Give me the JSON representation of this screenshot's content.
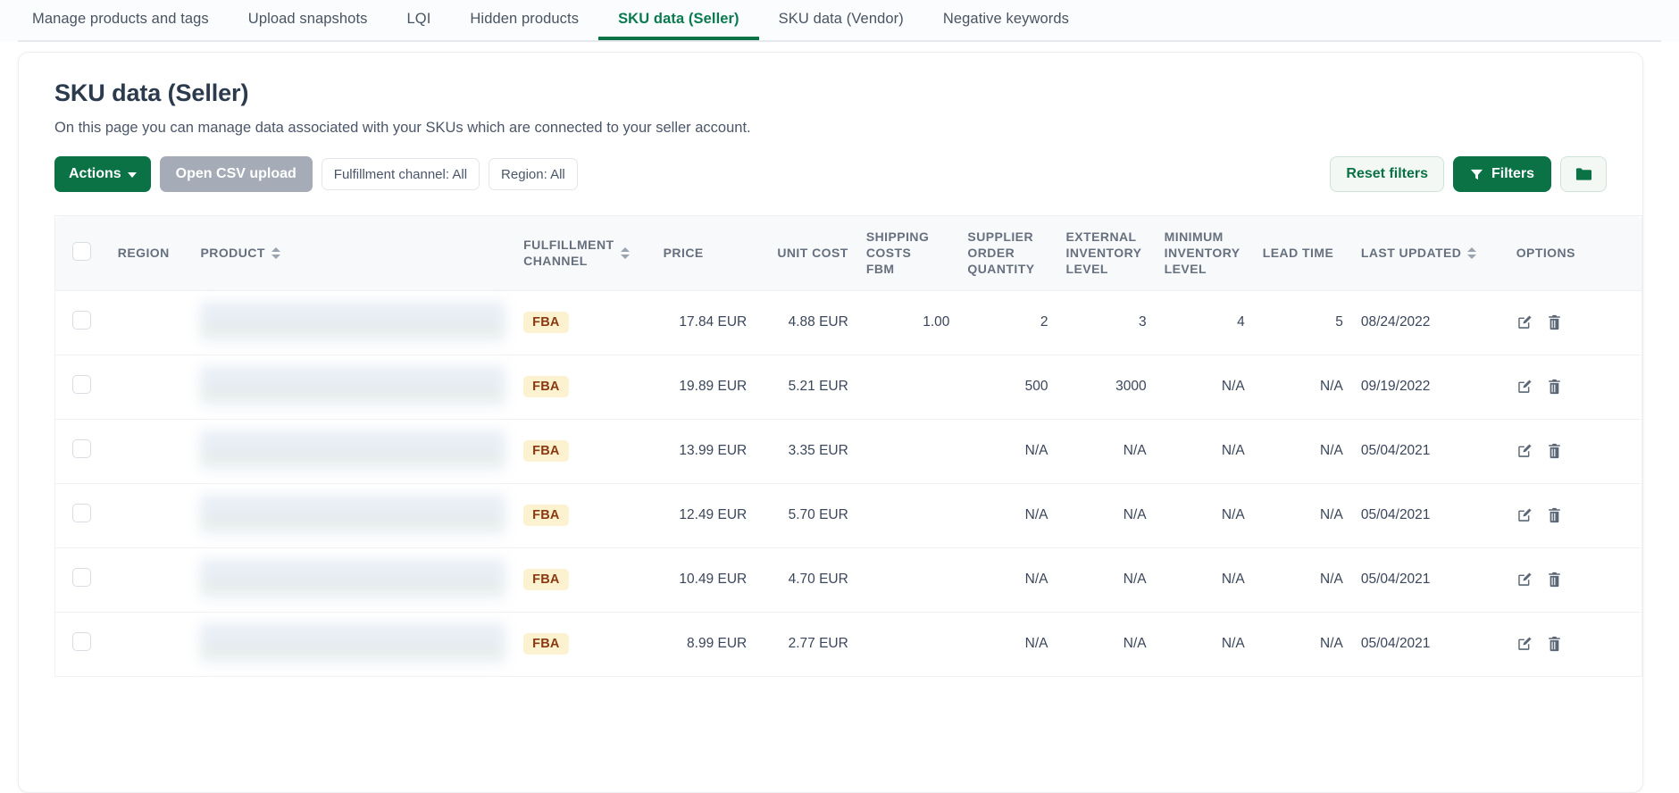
{
  "tabs": [
    {
      "label": "Manage products and tags",
      "active": false
    },
    {
      "label": "Upload snapshots",
      "active": false
    },
    {
      "label": "LQI",
      "active": false
    },
    {
      "label": "Hidden products",
      "active": false
    },
    {
      "label": "SKU data (Seller)",
      "active": true
    },
    {
      "label": "SKU data (Vendor)",
      "active": false
    },
    {
      "label": "Negative keywords",
      "active": false
    }
  ],
  "page": {
    "title": "SKU data (Seller)",
    "description": "On this page you can manage data associated with your SKUs which are connected to your seller account."
  },
  "toolbar": {
    "actions_label": "Actions",
    "csv_label": "Open CSV upload",
    "chip_fulfillment": "Fulfillment channel: All",
    "chip_region": "Region: All",
    "reset_label": "Reset filters",
    "filters_label": "Filters",
    "folder_icon": "folder-icon",
    "filter_icon": "funnel-icon"
  },
  "colors": {
    "brand_green": "#0a7245",
    "tab_active": "#0a7a4f",
    "na_red": "#f5333f",
    "badge_bg": "#fdf2cf",
    "badge_fg": "#8a3a12",
    "csv_gray": "#a5acb7"
  },
  "table": {
    "columns": [
      {
        "key": "select",
        "label": "",
        "sortable": false,
        "align": "center"
      },
      {
        "key": "region",
        "label": "REGION",
        "sortable": false,
        "align": "left"
      },
      {
        "key": "product",
        "label": "PRODUCT",
        "sortable": true,
        "align": "left"
      },
      {
        "key": "channel",
        "label": "FULFILLMENT CHANNEL",
        "sortable": true,
        "align": "left"
      },
      {
        "key": "price",
        "label": "PRICE",
        "sortable": false,
        "align": "right"
      },
      {
        "key": "unitcost",
        "label": "UNIT COST",
        "sortable": false,
        "align": "right"
      },
      {
        "key": "shipfbm",
        "label": "SHIPPING COSTS FBM",
        "sortable": false,
        "align": "right"
      },
      {
        "key": "supplier",
        "label": "SUPPLIER ORDER QUANTITY",
        "sortable": false,
        "align": "right"
      },
      {
        "key": "external",
        "label": "EXTERNAL INVENTORY LEVEL",
        "sortable": false,
        "align": "right"
      },
      {
        "key": "minimum",
        "label": "MINIMUM INVENTORY LEVEL",
        "sortable": false,
        "align": "right"
      },
      {
        "key": "leadtime",
        "label": "LEAD TIME",
        "sortable": false,
        "align": "right"
      },
      {
        "key": "updated",
        "label": "LAST UPDATED",
        "sortable": true,
        "align": "left"
      },
      {
        "key": "options",
        "label": "OPTIONS",
        "sortable": false,
        "align": "left"
      }
    ],
    "header_labels": {
      "region": "REGION",
      "product": "PRODUCT",
      "channel_line1": "FULFILLMENT",
      "channel_line2": "CHANNEL",
      "price": "PRICE",
      "unitcost": "UNIT COST",
      "ship_line1": "SHIPPING",
      "ship_line2": "COSTS",
      "ship_line3": "FBM",
      "supp_line1": "SUPPLIER",
      "supp_line2": "ORDER",
      "supp_line3": "QUANTITY",
      "ext_line1": "EXTERNAL",
      "ext_line2": "INVENTORY",
      "ext_line3": "LEVEL",
      "min_line1": "MINIMUM",
      "min_line2": "INVENTORY",
      "min_line3": "LEVEL",
      "leadtime": "LEAD TIME",
      "updated": "LAST UPDATED",
      "options": "OPTIONS"
    },
    "rows": [
      {
        "region": "",
        "product_redacted": true,
        "channel": "FBA",
        "price": "17.84 EUR",
        "unit_cost": "4.88 EUR",
        "shipping_fbm": "1.00",
        "supplier_order_quantity": "2",
        "external_inventory_level": "3",
        "minimum_inventory_level": "4",
        "lead_time": "5",
        "last_updated": "08/24/2022",
        "external_na": false,
        "minimum_na": false,
        "lead_na": false,
        "supplier_na": false
      },
      {
        "region": "",
        "product_redacted": true,
        "channel": "FBA",
        "price": "19.89 EUR",
        "unit_cost": "5.21 EUR",
        "shipping_fbm": "",
        "supplier_order_quantity": "500",
        "external_inventory_level": "3000",
        "minimum_inventory_level": "N/A",
        "lead_time": "N/A",
        "last_updated": "09/19/2022",
        "external_na": false,
        "minimum_na": true,
        "lead_na": true,
        "supplier_na": false
      },
      {
        "region": "",
        "product_redacted": true,
        "channel": "FBA",
        "price": "13.99 EUR",
        "unit_cost": "3.35 EUR",
        "shipping_fbm": "",
        "supplier_order_quantity": "N/A",
        "external_inventory_level": "N/A",
        "minimum_inventory_level": "N/A",
        "lead_time": "N/A",
        "last_updated": "05/04/2021",
        "external_na": true,
        "minimum_na": true,
        "lead_na": true,
        "supplier_na": true
      },
      {
        "region": "",
        "product_redacted": true,
        "channel": "FBA",
        "price": "12.49 EUR",
        "unit_cost": "5.70 EUR",
        "shipping_fbm": "",
        "supplier_order_quantity": "N/A",
        "external_inventory_level": "N/A",
        "minimum_inventory_level": "N/A",
        "lead_time": "N/A",
        "last_updated": "05/04/2021",
        "external_na": true,
        "minimum_na": true,
        "lead_na": true,
        "supplier_na": true
      },
      {
        "region": "",
        "product_redacted": true,
        "channel": "FBA",
        "price": "10.49 EUR",
        "unit_cost": "4.70 EUR",
        "shipping_fbm": "",
        "supplier_order_quantity": "N/A",
        "external_inventory_level": "N/A",
        "minimum_inventory_level": "N/A",
        "lead_time": "N/A",
        "last_updated": "05/04/2021",
        "external_na": true,
        "minimum_na": true,
        "lead_na": true,
        "supplier_na": true
      },
      {
        "region": "",
        "product_redacted": true,
        "channel": "FBA",
        "price": "8.99 EUR",
        "unit_cost": "2.77 EUR",
        "shipping_fbm": "",
        "supplier_order_quantity": "N/A",
        "external_inventory_level": "N/A",
        "minimum_inventory_level": "N/A",
        "lead_time": "N/A",
        "last_updated": "05/04/2021",
        "external_na": true,
        "minimum_na": true,
        "lead_na": true,
        "supplier_na": true
      }
    ],
    "row_icons": {
      "edit": "edit-icon",
      "delete": "trash-icon"
    }
  }
}
